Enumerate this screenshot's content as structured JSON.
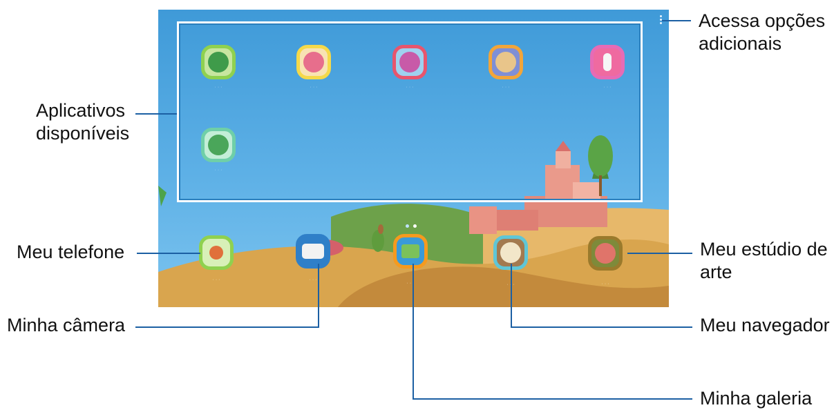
{
  "callouts": {
    "options": "Acessa opções",
    "options_line2": "adicionais",
    "apps": "Aplicativos",
    "apps_line2": "disponíveis",
    "phone": "Meu telefone",
    "camera": "Minha câmera",
    "art_studio": "Meu estúdio de",
    "art_studio_line2": "arte",
    "browser": "Meu navegador",
    "gallery": "Minha galeria"
  },
  "colors": {
    "callout_line": "#1b5fa3",
    "screen_sky": "#4ea6e0",
    "frame": "#ffffff"
  },
  "apps": [
    {
      "name": "app-1",
      "border": "#8fd14f",
      "icon": "dinosaur-icon"
    },
    {
      "name": "app-2",
      "border": "#f5d94a",
      "icon": "monster-icon"
    },
    {
      "name": "app-3",
      "border": "#e8556d",
      "icon": "bird-icon"
    },
    {
      "name": "app-4",
      "border": "#f2a53a",
      "icon": "dog-icon"
    },
    {
      "name": "app-5",
      "border": "#e66bb6",
      "icon": "microphone-icon"
    },
    {
      "name": "app-6",
      "border": "#6fcfa8",
      "icon": "dinosaur-icon"
    }
  ],
  "dock": [
    {
      "name": "my-phone",
      "border": "#8fd14f",
      "icon": "phone-icon"
    },
    {
      "name": "my-camera",
      "border": "#2f7fc8",
      "icon": "camera-icon"
    },
    {
      "name": "my-gallery",
      "border": "#f59a1e",
      "icon": "picture-icon"
    },
    {
      "name": "my-browser",
      "border": "#5fc6d6",
      "icon": "compass-icon"
    },
    {
      "name": "my-art-studio",
      "border": "#9a7a2c",
      "icon": "art-character-icon"
    }
  ]
}
